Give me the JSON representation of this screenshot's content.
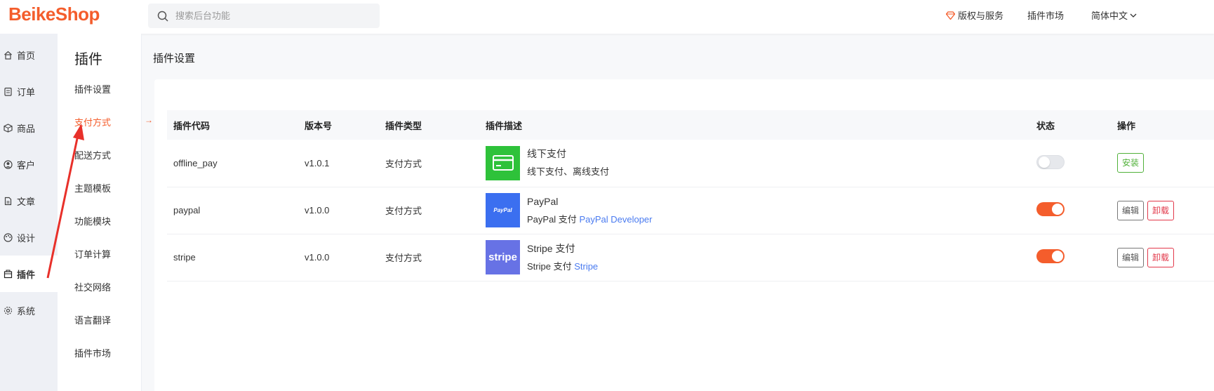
{
  "header": {
    "logo": "BeikeShop",
    "search_placeholder": "搜索后台功能",
    "links": [
      "版权与服务",
      "插件市场",
      "简体中文"
    ]
  },
  "leftnav": {
    "items": [
      {
        "label": "首页",
        "icon": "home-icon"
      },
      {
        "label": "订单",
        "icon": "order-icon"
      },
      {
        "label": "商品",
        "icon": "product-icon"
      },
      {
        "label": "客户",
        "icon": "customer-icon"
      },
      {
        "label": "文章",
        "icon": "article-icon"
      },
      {
        "label": "设计",
        "icon": "palette-icon"
      },
      {
        "label": "插件",
        "icon": "plugin-icon",
        "active": true
      },
      {
        "label": "系统",
        "icon": "gear-icon"
      }
    ]
  },
  "subnav": {
    "title": "插件",
    "items": [
      "插件设置",
      "支付方式",
      "配送方式",
      "主题模板",
      "功能模块",
      "订单计算",
      "社交网络",
      "语言翻译",
      "插件市场"
    ],
    "active_index": 1,
    "active_arrow": "→"
  },
  "page": {
    "title": "插件设置"
  },
  "table": {
    "headers": [
      "插件代码",
      "版本号",
      "插件类型",
      "插件描述",
      "状态",
      "操作"
    ],
    "rows": [
      {
        "code": "offline_pay",
        "version": "v1.0.1",
        "type": "支付方式",
        "desc_title": "线下支付",
        "desc_text": "线下支付、离线支付",
        "desc_link": "",
        "thumb": "offline-pay-logo",
        "thumb_color": "#2ec23a",
        "enabled": false,
        "actions": [
          "安装"
        ]
      },
      {
        "code": "paypal",
        "version": "v1.0.0",
        "type": "支付方式",
        "desc_title": "PayPal",
        "desc_text": "PayPal 支付",
        "desc_link": "PayPal Developer",
        "thumb": "paypal-logo",
        "thumb_label": "PayPal",
        "thumb_color": "#3b6ff0",
        "enabled": true,
        "actions": [
          "编辑",
          "卸载"
        ]
      },
      {
        "code": "stripe",
        "version": "v1.0.0",
        "type": "支付方式",
        "desc_title": "Stripe 支付",
        "desc_text": "Stripe 支付",
        "desc_link": "Stripe",
        "thumb": "stripe-logo",
        "thumb_label": "stripe",
        "thumb_color": "#6772e5",
        "enabled": true,
        "actions": [
          "编辑",
          "卸载"
        ]
      }
    ]
  },
  "colors": {
    "brand": "#f45d2c",
    "link": "#4a7bf0",
    "install": "#51b13a",
    "uninstall": "#e2384a"
  }
}
